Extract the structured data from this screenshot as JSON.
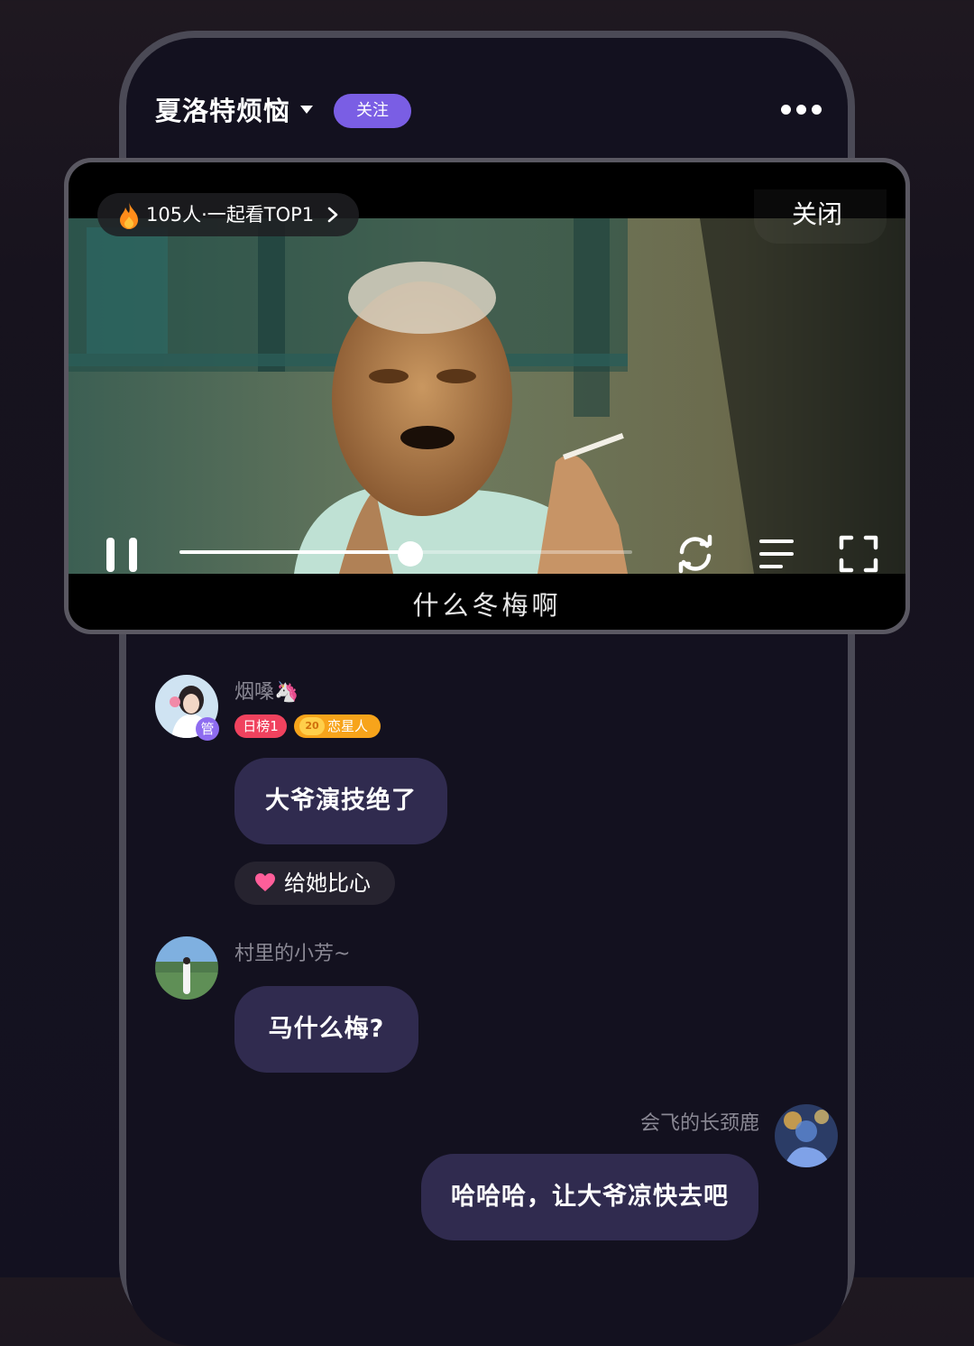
{
  "header": {
    "room_title": "夏洛特烦恼",
    "follow_label": "关注"
  },
  "player": {
    "watching_text": "105人·一起看TOP1",
    "close_label": "关闭",
    "subtitle": "什么冬梅啊",
    "progress": 0.51
  },
  "chat": [
    {
      "username": "烟嗓🦄",
      "admin_badge": "管",
      "tags": [
        "日榜1",
        "20",
        "恋星人"
      ],
      "message": "大爷演技绝了",
      "reaction_label": "给她比心"
    },
    {
      "username": "村里的小芳~",
      "message": "马什么梅?"
    },
    {
      "username": "会飞的长颈鹿",
      "message": "哈哈哈，让大爷凉快去吧"
    }
  ],
  "colors": {
    "background": "#13111f",
    "accent": "#7a5ee4",
    "bubble": "#302b4f",
    "tag_red": "#f0425e",
    "tag_orange": "#f7a41b",
    "heart": "#ff5e9a"
  },
  "icons": [
    "dropdown-caret-icon",
    "more-icon",
    "flame-icon",
    "chevron-right-icon",
    "pause-icon",
    "repeat-icon",
    "playlist-icon",
    "fullscreen-icon",
    "heart-icon"
  ]
}
